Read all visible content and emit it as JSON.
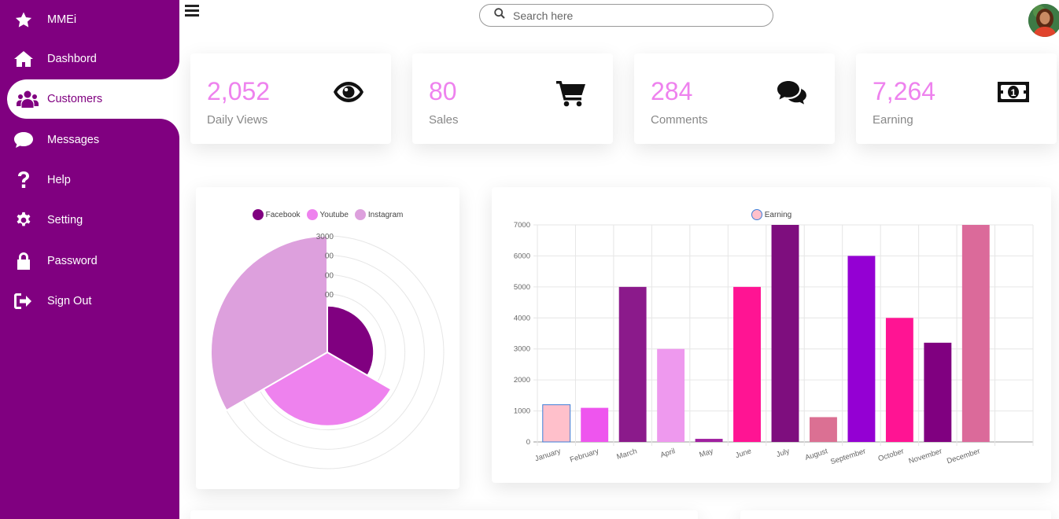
{
  "sidebar": {
    "items": [
      {
        "label": "MMEi",
        "icon": "star-icon"
      },
      {
        "label": "Dashbord",
        "icon": "home-icon"
      },
      {
        "label": "Customers",
        "icon": "users-icon",
        "active": true
      },
      {
        "label": "Messages",
        "icon": "chat-icon"
      },
      {
        "label": "Help",
        "icon": "question-icon"
      },
      {
        "label": "Setting",
        "icon": "gear-icon"
      },
      {
        "label": "Password",
        "icon": "lock-icon"
      },
      {
        "label": "Sign Out",
        "icon": "sign-out-icon"
      }
    ]
  },
  "topbar": {
    "search_placeholder": "Search here"
  },
  "cards": [
    {
      "number": "2,052",
      "label": "Daily Views",
      "icon": "eye-icon"
    },
    {
      "number": "80",
      "label": "Sales",
      "icon": "cart-icon"
    },
    {
      "number": "284",
      "label": "Comments",
      "icon": "comments-icon"
    },
    {
      "number": "7,264",
      "label": "Earning",
      "icon": "money-icon"
    }
  ],
  "colors": {
    "sidebar": "#800080",
    "accent": "#ee82ee"
  },
  "chart_data": [
    {
      "type": "polarArea",
      "legend": [
        "Facebook",
        "Youtube",
        "Instagram"
      ],
      "legend_position": "top",
      "values": [
        1200,
        1900,
        3000
      ],
      "colors": [
        "#800080",
        "#ee82ee",
        "#dda0dd"
      ],
      "r_ticks": [
        0,
        500,
        1000,
        1500,
        2000,
        2500,
        3000
      ],
      "visible_tick_labels": [
        "3000",
        "00",
        "00",
        "00"
      ]
    },
    {
      "type": "bar",
      "legend": [
        "Earning"
      ],
      "legend_position": "top",
      "categories": [
        "January",
        "February",
        "March",
        "April",
        "May",
        "June",
        "July",
        "August",
        "September",
        "October",
        "November",
        "December"
      ],
      "values": [
        1200,
        1100,
        5000,
        3000,
        100,
        5000,
        7000,
        800,
        6000,
        4000,
        3200,
        7000
      ],
      "colors": [
        "#ffc0cb",
        "#ee55ee",
        "#8b1a8b",
        "#ee99ee",
        "#a020a0",
        "#ff1493",
        "#7e0e7e",
        "#db7093",
        "#9400d3",
        "#ff1493",
        "#800080",
        "#db6a9a"
      ],
      "ylim": [
        0,
        7000
      ],
      "yticks": [
        0,
        1000,
        2000,
        3000,
        4000,
        5000,
        6000,
        7000
      ],
      "grid": true
    }
  ]
}
